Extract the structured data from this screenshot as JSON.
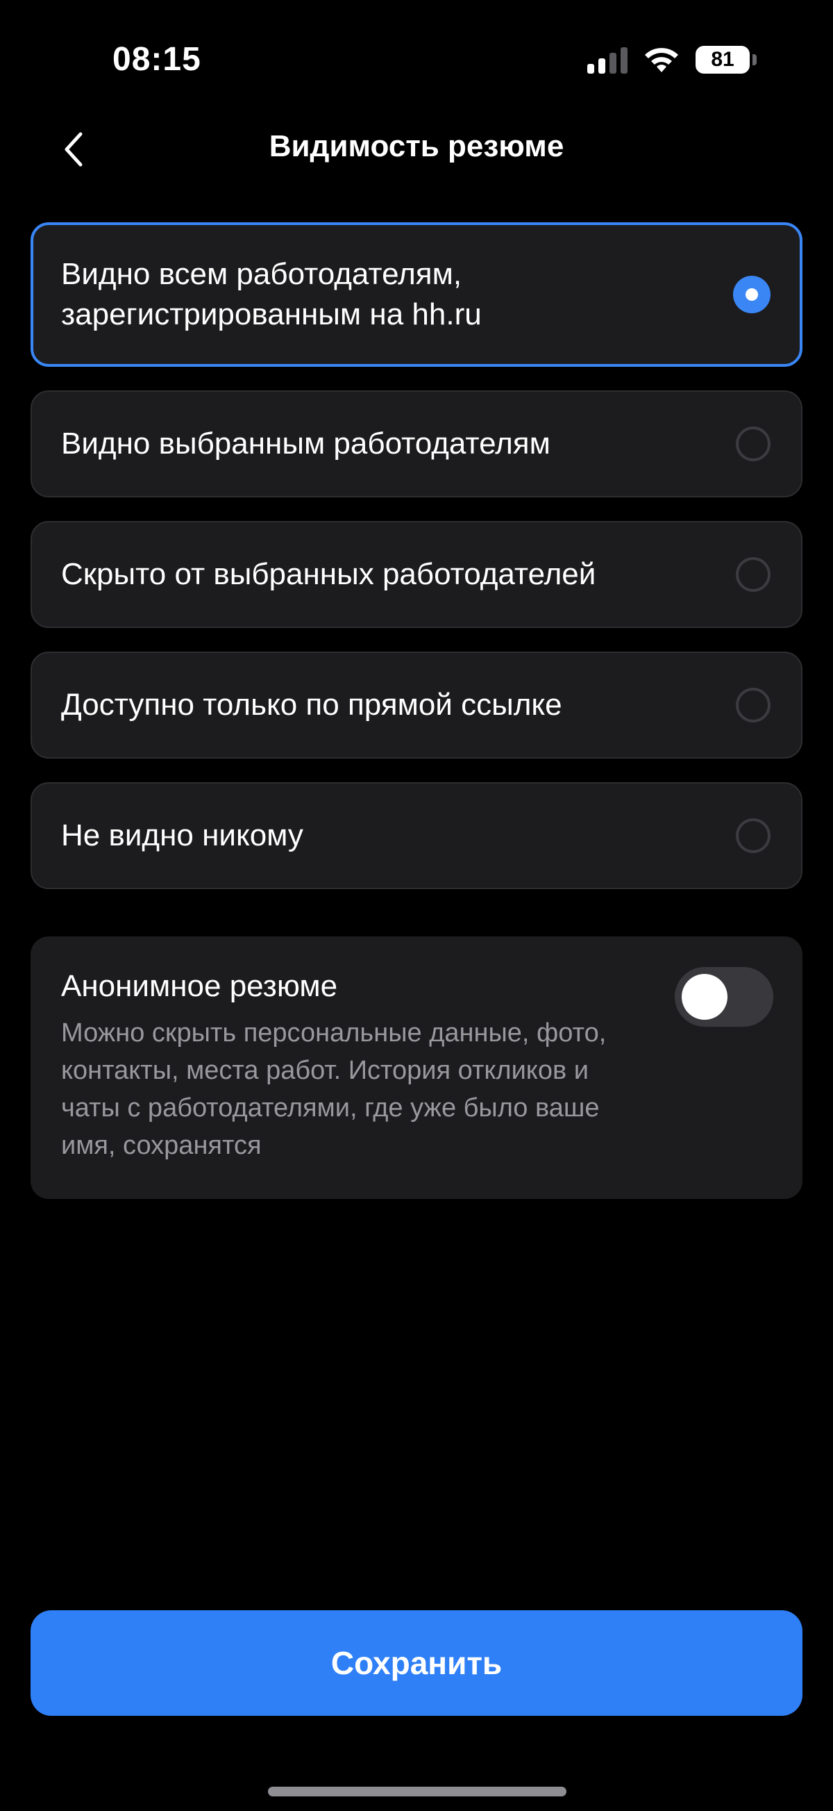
{
  "status_bar": {
    "time": "08:15",
    "battery": "81",
    "signal_icon": "cellular-signal-icon",
    "wifi_icon": "wifi-icon"
  },
  "header": {
    "title": "Видимость резюме",
    "back_icon": "chevron-left-icon"
  },
  "options": [
    {
      "label": "Видно всем работодателям, зарегистрированным на hh.ru",
      "selected": true
    },
    {
      "label": "Видно выбранным работодателям",
      "selected": false
    },
    {
      "label": "Скрыто от выбранных работодателей",
      "selected": false
    },
    {
      "label": "Доступно только по прямой ссылке",
      "selected": false
    },
    {
      "label": "Не видно никому",
      "selected": false
    }
  ],
  "anonymous": {
    "title": "Анонимное резюме",
    "description": "Можно скрыть персональные данные, фото, контакты, места работ. История откликов и чаты с работодателями, где уже было ваше имя, сохранятся",
    "enabled": false
  },
  "save_label": "Сохранить",
  "colors": {
    "accent": "#2f80f7",
    "selected_border": "#3a86f5",
    "card_background": "#1c1c1e",
    "page_background": "#000000",
    "secondary_text": "#98989d"
  }
}
